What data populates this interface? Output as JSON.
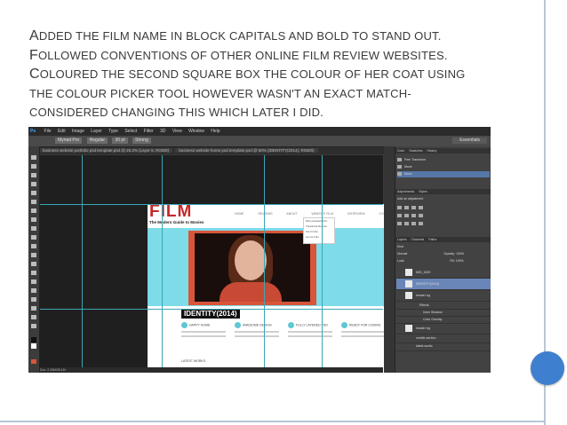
{
  "slide": {
    "lines": [
      "Added the film name in block capitals and bold to stand out.",
      "Followed conventions of other online film review websites.",
      "Coloured the second square box the colour of her coat using",
      "the colour picker tool however wasn't an exact match-",
      "considered changing this which later I did."
    ],
    "accent_color": "#3f7fcf"
  },
  "photoshop": {
    "app_icon": "Ps",
    "menus": [
      "File",
      "Edit",
      "Image",
      "Layer",
      "Type",
      "Select",
      "Filter",
      "3D",
      "View",
      "Window",
      "Help"
    ],
    "options": {
      "font": "Myriad Pro",
      "style": "Regular",
      "size": "30 pt",
      "aa": "Strong"
    },
    "workspace": "Essentials",
    "tabs": [
      "business website portfolio psd template.psd @ 25.2% (Layer 5, RGB/8)",
      "business website home psd template.psd @ 50% (IDENTITY(2014), RGB/8)"
    ],
    "status": "Doc: 2.26M/35.1M",
    "history_panel": {
      "tabs": [
        "Color",
        "Swatches",
        "History"
      ],
      "items": [
        "Free Transform",
        "Move",
        "Move"
      ]
    },
    "adjustments_panel": {
      "tabs": [
        "Adjustments",
        "Styles"
      ],
      "title": "Add an adjustment"
    },
    "layers_panel": {
      "tabs": [
        "Layers",
        "Channels",
        "Paths"
      ],
      "kind": "Kind",
      "blend": "Normal",
      "opacity": "Opacity: 100%",
      "lock": "Lock:",
      "fill": "Fill: 100%",
      "layers": [
        {
          "name": "IMG_1829",
          "selected": false
        },
        {
          "name": "IDENTITY(2014)",
          "selected": true
        },
        {
          "name": "header bg",
          "selected": false
        },
        {
          "name": "Effects",
          "selected": false
        },
        {
          "name": "Inner Shadow",
          "selected": false
        },
        {
          "name": "Color Overlay",
          "selected": false
        },
        {
          "name": "header bg",
          "selected": false
        },
        {
          "name": "mobile-section",
          "selected": false
        },
        {
          "name": "latest-works",
          "selected": false
        }
      ]
    }
  },
  "website": {
    "logo": "FILM",
    "tagline": "The Modern Guide to Movies",
    "nav": [
      "HOME",
      "REVIEWS",
      "ABOUT",
      "WEBSITE FILM",
      "INTERVIEW",
      "CONTACT US"
    ],
    "dropdown": [
      "Most Awaited Film",
      "Theatrical Review",
      "Sci-Fi Film",
      "Horror Film"
    ],
    "headline": "IDENTITY(2014)",
    "features": [
      "HAPPY HOME",
      "AWESOME DESIGN",
      "FULLY LAYERED PSD",
      "READY FOR CODING"
    ],
    "latest": "LATEST WORKS",
    "cyan": "#7edbe8",
    "coat": "#d8553a"
  }
}
